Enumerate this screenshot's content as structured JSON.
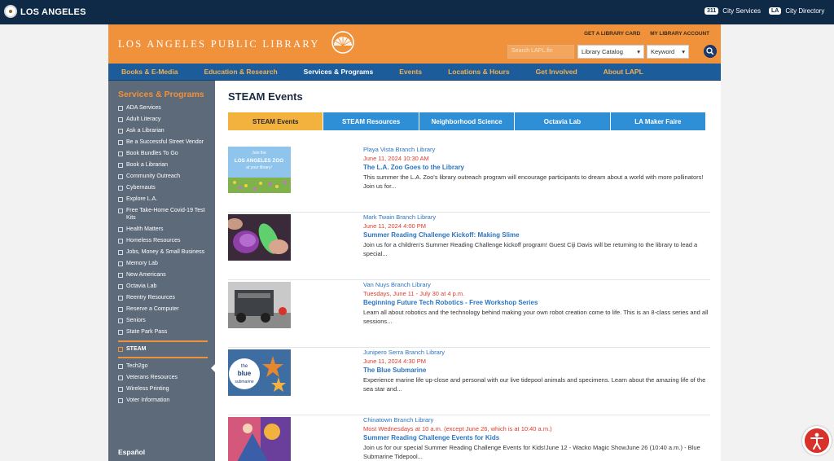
{
  "city": {
    "name": "LOS ANGELES",
    "services_badge": "311",
    "services_label": "City Services",
    "directory_badge": "LA",
    "directory_label": "City Directory"
  },
  "header": {
    "library_name": "LOS ANGELES PUBLIC LIBRARY",
    "links": [
      "GET A LIBRARY CARD",
      "MY LIBRARY ACCOUNT"
    ],
    "search_placeholder": "Search LAPL.fin",
    "catalog_select": "Library Catalog",
    "keyword_select": "Keyword"
  },
  "nav": [
    "Books & E-Media",
    "Education & Research",
    "Services & Programs",
    "Events",
    "Locations & Hours",
    "Get Involved",
    "About LAPL"
  ],
  "nav_active": "Services & Programs",
  "sidebar": {
    "title": "Services & Programs",
    "items": [
      "ADA Services",
      "Adult Literacy",
      "Ask a Librarian",
      "Be a Successful Street Vendor",
      "Book Bundles To Go",
      "Book a Librarian",
      "Community Outreach",
      "Cybernauts",
      "Explore L.A.",
      "Free Take-Home Covid-19 Test Kits",
      "Health Matters",
      "Homeless Resources",
      "Jobs, Money & Small Business",
      "Memory Lab",
      "New Americans",
      "Octavia Lab",
      "Reentry Resources",
      "Reserve a Computer",
      "Seniors",
      "State Park Pass",
      "STEAM",
      "Tech2go",
      "Veterans Resources",
      "Wireless Printing",
      "Voter Information"
    ],
    "current": "STEAM",
    "language": "Español"
  },
  "main": {
    "title": "STEAM Events",
    "tabs": [
      "STEAM Events",
      "STEAM Resources",
      "Neighborhood Science",
      "Octavia Lab",
      "LA Maker Faire"
    ],
    "active_tab": "STEAM Events",
    "events": [
      {
        "branch": "Playa Vista Branch Library",
        "when": "June 11, 2024 10:30 AM",
        "title": "The L.A. Zoo Goes to the Library",
        "description": "This summer the L.A. Zoo's library outreach program will encourage participants to dream about a world with more pollinators! Join us for...",
        "thumb_text": [
          "Join the",
          "LOS ANGELES ZOO",
          "at your library!"
        ]
      },
      {
        "branch": "Mark Twain Branch Library",
        "when": "June 11, 2024 4:00 PM",
        "title": "Summer Reading Challenge Kickoff: Making Slime",
        "description": "Join us for a children's Summer Reading Challenge kickoff program! Guest Ciji Davis will be returning to the library to lead a special..."
      },
      {
        "branch": "Van Nuys Branch Library",
        "when": "Tuesdays, June 11 - July 30 at 4 p.m.",
        "title": "Beginning Future Tech Robotics - Free Workshop Series",
        "description": "Learn all about robotics and the technology behind making your own robot creation come to life. This is an 8-class series and all sessions..."
      },
      {
        "branch": "Junipero Serra Branch Library",
        "when": "June 11, 2024 4:30 PM",
        "title": "The Blue Submarine",
        "description": "Experience marine life up-close and personal with our live tidepool animals and specimens. Learn about the amazing life of the sea star and...",
        "thumb_text": [
          "the",
          "blue",
          "submarine"
        ]
      },
      {
        "branch": "Chinatown Branch Library",
        "when": "Most Wednesdays at 10 a.m. (except June 26, which is at 10:40 a.m.)",
        "title": "Summer Reading Challenge Events for Kids",
        "description": "Join us for our special Summer Reading Challenge Events for Kids!June 12 - Wacko Magic ShowJune 26 (10:40 a.m.) - Blue Submarine Tidepool..."
      }
    ]
  },
  "colors": {
    "top_bar": "#0f2a47",
    "brand_orange": "#f0913b",
    "nav_blue": "#1d5c9b",
    "sidebar_gray": "#5d6a7a",
    "tab_blue": "#2e8fd6",
    "tab_active": "#f2b23d",
    "link_blue": "#2b74c0",
    "date_red": "#e03a2a"
  }
}
